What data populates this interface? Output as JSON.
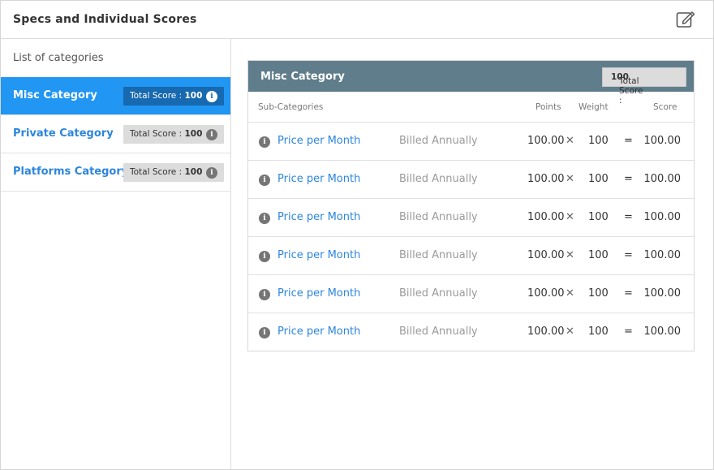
{
  "header": {
    "title": "Specs and Individual Scores",
    "edit_icon": "edit-icon"
  },
  "sidebar": {
    "heading": "List of categories",
    "categories": [
      {
        "name": "Misc Category",
        "score_label": "Total Score : ",
        "score_value": "100",
        "active": true
      },
      {
        "name": "Private Category",
        "score_label": "Total Score : ",
        "score_value": "100",
        "active": false
      },
      {
        "name": "Platforms Category",
        "score_label": "Total Score : ",
        "score_value": "100",
        "active": false
      }
    ]
  },
  "panel": {
    "title": "Misc Category",
    "score_label": "Total Score : ",
    "score_value": "100",
    "columns": {
      "sub": "Sub-Categories",
      "points": "Points",
      "weight": "Weight",
      "score": "Score"
    },
    "rows": [
      {
        "name": "Price per Month",
        "billing": "Billed Annually",
        "points": "100.00",
        "times": "✕",
        "weight": "100",
        "equals": "=",
        "score": "100.00"
      },
      {
        "name": "Price per Month",
        "billing": "Billed Annually",
        "points": "100.00",
        "times": "✕",
        "weight": "100",
        "equals": "=",
        "score": "100.00"
      },
      {
        "name": "Price per Month",
        "billing": "Billed Annually",
        "points": "100.00",
        "times": "✕",
        "weight": "100",
        "equals": "=",
        "score": "100.00"
      },
      {
        "name": "Price per Month",
        "billing": "Billed Annually",
        "points": "100.00",
        "times": "✕",
        "weight": "100",
        "equals": "=",
        "score": "100.00"
      },
      {
        "name": "Price per Month",
        "billing": "Billed Annually",
        "points": "100.00",
        "times": "✕",
        "weight": "100",
        "equals": "=",
        "score": "100.00"
      },
      {
        "name": "Price per Month",
        "billing": "Billed Annually",
        "points": "100.00",
        "times": "✕",
        "weight": "100",
        "equals": "=",
        "score": "100.00"
      }
    ]
  },
  "icons": {
    "info": "info-icon",
    "multiply": "multiply-icon"
  },
  "colors": {
    "accent": "#2196f3",
    "accent_dark": "#1769b0",
    "panel_header": "#607d8b",
    "link": "#2d86dc"
  }
}
